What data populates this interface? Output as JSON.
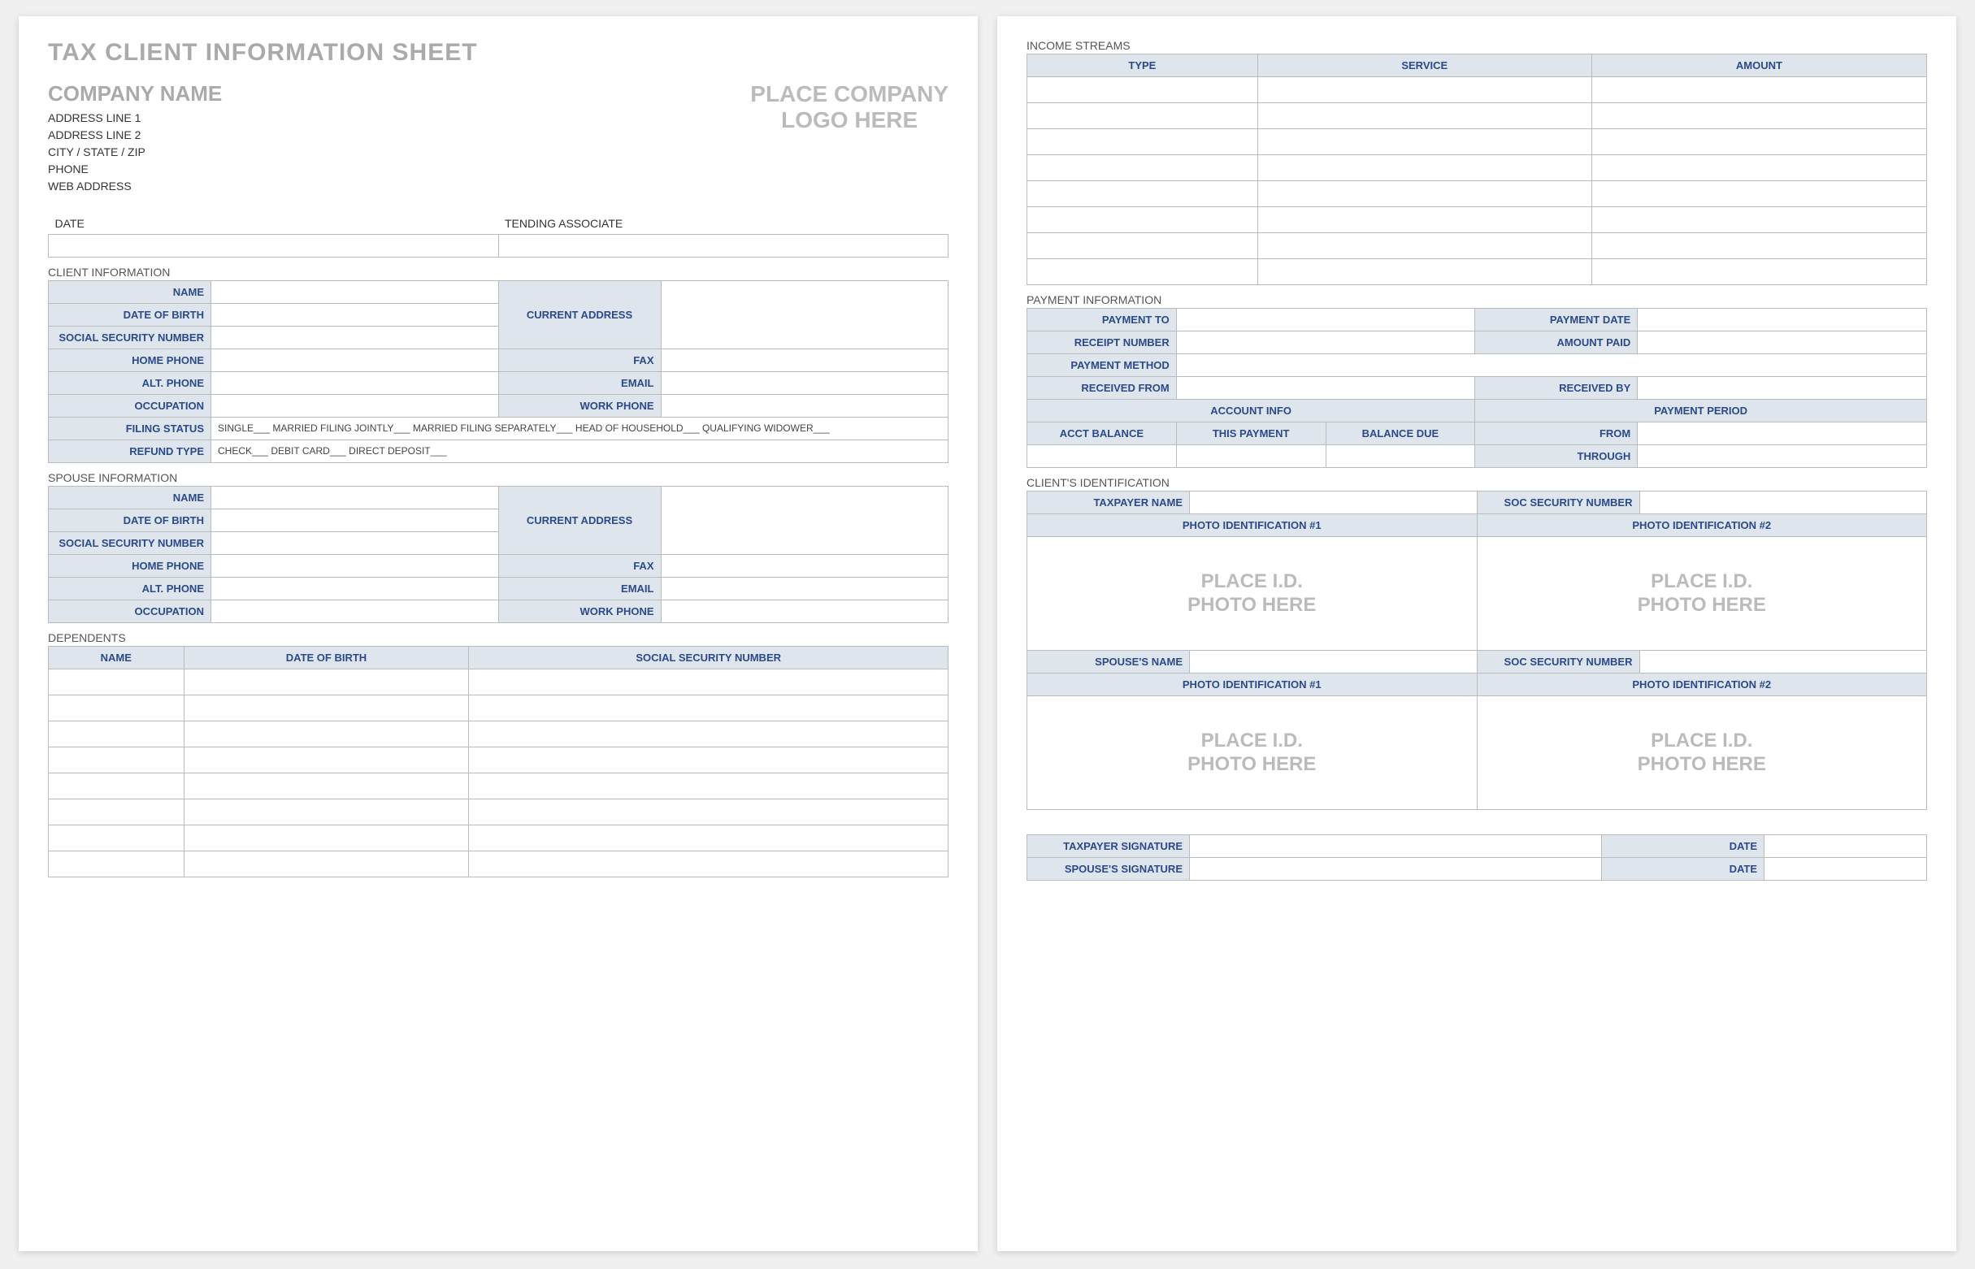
{
  "main_title": "TAX CLIENT INFORMATION SHEET",
  "company_name": "COMPANY NAME",
  "address": [
    "ADDRESS LINE 1",
    "ADDRESS LINE 2",
    "CITY / STATE / ZIP",
    "PHONE",
    "WEB ADDRESS"
  ],
  "logo_line1": "PLACE COMPANY",
  "logo_line2": "LOGO HERE",
  "date_label": "DATE",
  "tending_label": "TENDING ASSOCIATE",
  "client_info_title": "CLIENT INFORMATION",
  "spouse_info_title": "SPOUSE INFORMATION",
  "dependents_title": "DEPENDENTS",
  "fields": {
    "name": "NAME",
    "dob": "DATE OF BIRTH",
    "ssn": "SOCIAL SECURITY NUMBER",
    "home_phone": "HOME PHONE",
    "alt_phone": "ALT. PHONE",
    "occupation": "OCCUPATION",
    "current_address": "CURRENT ADDRESS",
    "fax": "FAX",
    "email": "EMAIL",
    "work_phone": "WORK PHONE",
    "filing_status": "FILING STATUS",
    "refund_type": "REFUND TYPE"
  },
  "filing_opts": "SINGLE___   MARRIED FILING JOINTLY___   MARRIED FILING SEPARATELY___   HEAD OF HOUSEHOLD___   QUALIFYING WIDOWER___",
  "refund_opts": "CHECK___   DEBIT CARD___   DIRECT DEPOSIT___",
  "dep_headers": [
    "NAME",
    "DATE OF BIRTH",
    "SOCIAL SECURITY NUMBER"
  ],
  "income_title": "INCOME STREAMS",
  "income_headers": [
    "TYPE",
    "SERVICE",
    "AMOUNT"
  ],
  "payment_title": "PAYMENT INFORMATION",
  "payment": {
    "payment_to": "PAYMENT TO",
    "payment_date": "PAYMENT DATE",
    "receipt_number": "RECEIPT NUMBER",
    "amount_paid": "AMOUNT PAID",
    "payment_method": "PAYMENT METHOD",
    "received_from": "RECEIVED FROM",
    "received_by": "RECEIVED BY",
    "account_info": "ACCOUNT INFO",
    "payment_period": "PAYMENT PERIOD",
    "acct_balance": "ACCT BALANCE",
    "this_payment": "THIS PAYMENT",
    "balance_due": "BALANCE DUE",
    "from": "FROM",
    "through": "THROUGH"
  },
  "client_id_title": "CLIENT'S IDENTIFICATION",
  "id": {
    "taxpayer_name": "TAXPAYER NAME",
    "spouse_name": "SPOUSE'S NAME",
    "ssn": "SOC SECURITY NUMBER",
    "photo1": "PHOTO IDENTIFICATION #1",
    "photo2": "PHOTO IDENTIFICATION #2",
    "photo_place1": "PLACE I.D.",
    "photo_place2": "PHOTO HERE"
  },
  "sig": {
    "taxpayer": "TAXPAYER SIGNATURE",
    "spouse": "SPOUSE'S SIGNATURE",
    "date": "DATE"
  }
}
